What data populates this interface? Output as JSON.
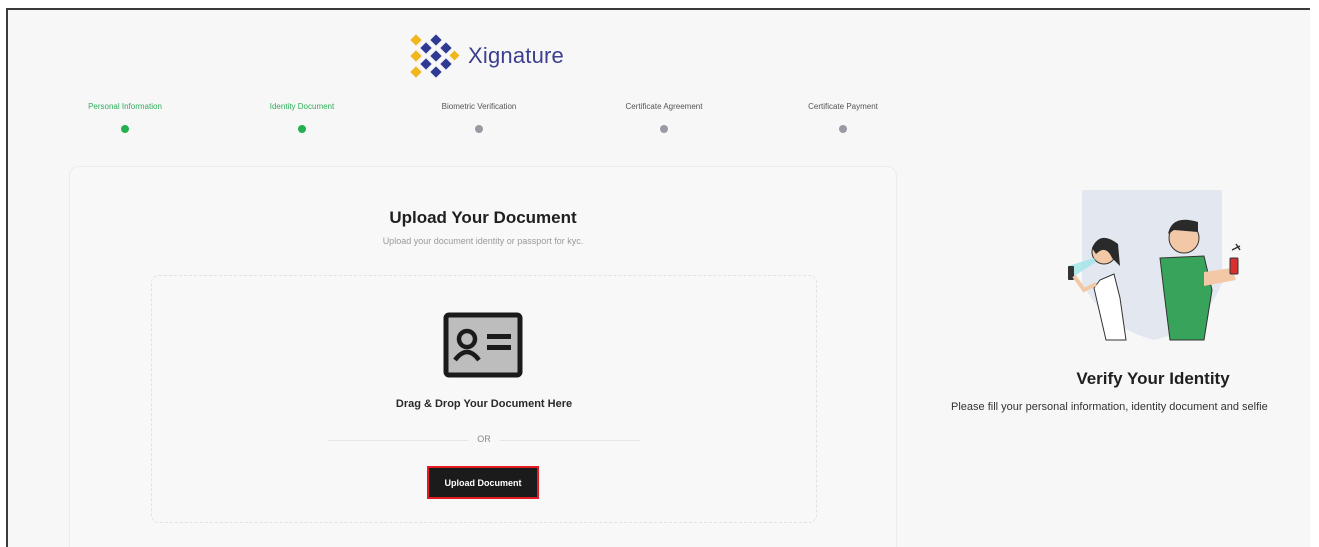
{
  "brand": {
    "name": "Xignature"
  },
  "steps": [
    {
      "label": "Personal Information",
      "status": "done"
    },
    {
      "label": "Identity Document",
      "status": "done"
    },
    {
      "label": "Biometric Verification",
      "status": "pending"
    },
    {
      "label": "Certificate Agreement",
      "status": "pending"
    },
    {
      "label": "Certificate Payment",
      "status": "pending"
    }
  ],
  "upload": {
    "title": "Upload Your Document",
    "subtitle": "Upload your document identity or passport for kyc.",
    "drop_text": "Drag & Drop Your Document Here",
    "or_text": "OR",
    "button_label": "Upload Document"
  },
  "side": {
    "title": "Verify Your Identity",
    "description": "Please fill your personal information, identity document and selfie"
  },
  "colors": {
    "step_done": "#25b04e",
    "step_pending": "#9a9aa4",
    "brand_text": "#3b3f8c",
    "button_bg": "#1b1b1b",
    "button_highlight": "#e31b23"
  },
  "icons": {
    "logo": "xignature-logo-mark",
    "document": "id-card-icon",
    "illustration": "identity-verification-illustration"
  }
}
